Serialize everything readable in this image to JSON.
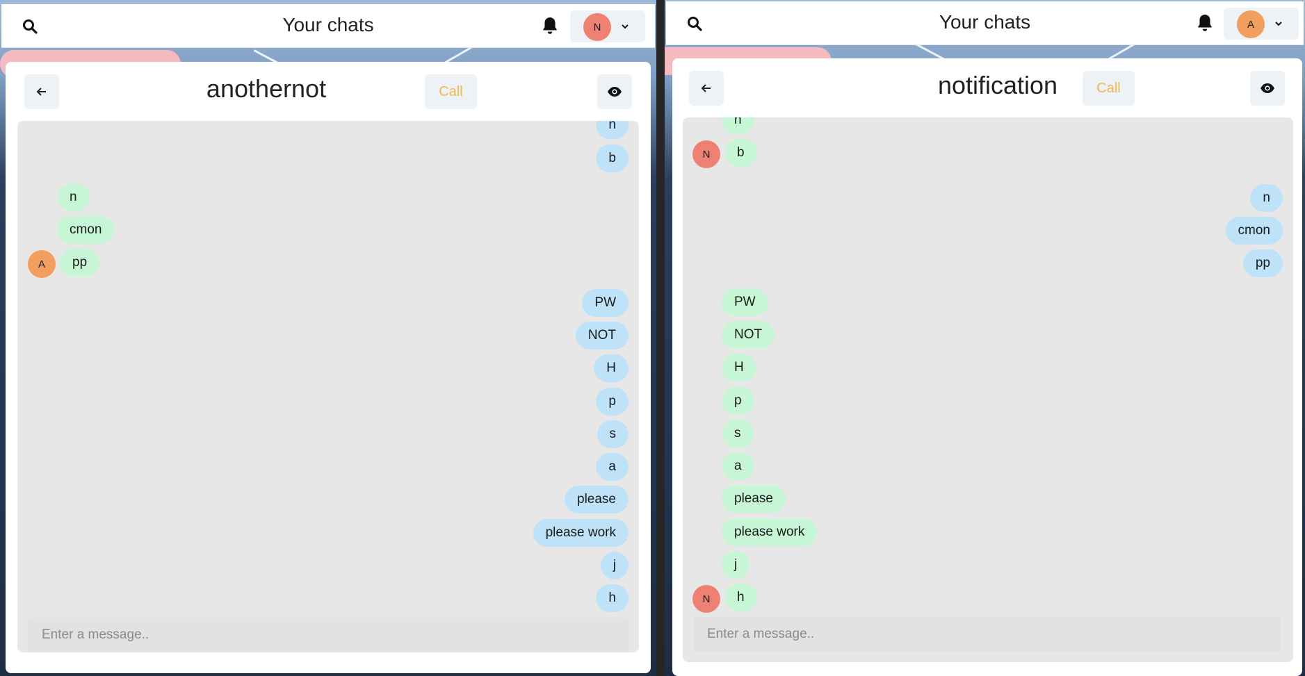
{
  "colors": {
    "accent_call": "#f0b84a",
    "bubble_blue": "#bee3f8",
    "bubble_green": "#c6f6d5",
    "avatar_n": "#ee8172",
    "avatar_a": "#f19e5e",
    "chat_area": "#e7e7e7"
  },
  "left": {
    "topbar": {
      "title": "Your chats",
      "user_initial": "N"
    },
    "chat": {
      "title": "anothernot",
      "call_label": "Call",
      "placeholder": "Enter a message..",
      "sender_initial": "A",
      "messages": [
        {
          "text": "n",
          "side": "right"
        },
        {
          "text": "b",
          "side": "right"
        },
        {
          "text": "n",
          "side": "left"
        },
        {
          "text": "cmon",
          "side": "left"
        },
        {
          "text": "pp",
          "side": "left",
          "avatar": true
        },
        {
          "text": "PW",
          "side": "right"
        },
        {
          "text": "NOT",
          "side": "right"
        },
        {
          "text": "H",
          "side": "right"
        },
        {
          "text": "p",
          "side": "right"
        },
        {
          "text": "s",
          "side": "right"
        },
        {
          "text": "a",
          "side": "right"
        },
        {
          "text": "please",
          "side": "right"
        },
        {
          "text": "please work",
          "side": "right"
        },
        {
          "text": "j",
          "side": "right"
        },
        {
          "text": "h",
          "side": "right"
        }
      ]
    }
  },
  "right": {
    "topbar": {
      "title": "Your chats",
      "user_initial": "A"
    },
    "chat": {
      "title": "notification",
      "call_label": "Call",
      "placeholder": "Enter a message..",
      "sender_initial": "N",
      "messages": [
        {
          "text": "n",
          "side": "left"
        },
        {
          "text": "b",
          "side": "left",
          "avatar": true
        },
        {
          "text": "n",
          "side": "right"
        },
        {
          "text": "cmon",
          "side": "right"
        },
        {
          "text": "pp",
          "side": "right"
        },
        {
          "text": "PW",
          "side": "left"
        },
        {
          "text": "NOT",
          "side": "left"
        },
        {
          "text": "H",
          "side": "left"
        },
        {
          "text": "p",
          "side": "left"
        },
        {
          "text": "s",
          "side": "left"
        },
        {
          "text": "a",
          "side": "left"
        },
        {
          "text": "please",
          "side": "left"
        },
        {
          "text": "please work",
          "side": "left"
        },
        {
          "text": "j",
          "side": "left"
        },
        {
          "text": "h",
          "side": "left",
          "avatar": true
        }
      ]
    }
  }
}
